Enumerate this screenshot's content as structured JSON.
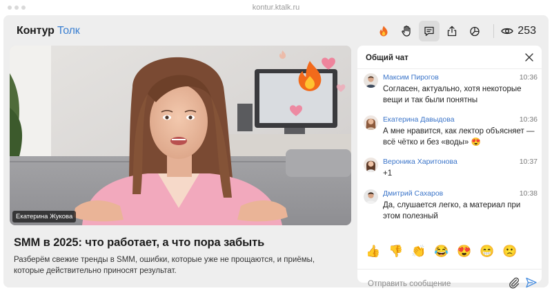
{
  "browser": {
    "url": "kontur.ktalk.ru"
  },
  "header": {
    "logo_brand": "Контур",
    "logo_product": "Толк",
    "viewer_count": "253",
    "toolbar_icons": [
      "fire-icon",
      "raise-hand-icon",
      "chat-icon",
      "share-icon",
      "poll-icon"
    ]
  },
  "video": {
    "speaker_name": "Екатерина Жукова",
    "reactions": [
      "fire",
      "heart",
      "heart",
      "heart",
      "fire"
    ]
  },
  "talk": {
    "title": "SMM в 2025: что работает, а что пора забыть",
    "description": "Разберём свежие тренды в SMM, ошибки, которые уже не прощаются, и приёмы, которые действительно приносят результат."
  },
  "chat": {
    "title": "Общий чат",
    "messages": [
      {
        "author": "Максим Пирогов",
        "time": "10:36",
        "text": "Согласен, актуально, хотя некоторые вещи и так были понятны"
      },
      {
        "author": "Екатерина Давыдова",
        "time": "10:36",
        "text": "А мне нравится, как лектор объясняет — всё чётко и без «воды» 😍"
      },
      {
        "author": "Вероника Харитонова",
        "time": "10:37",
        "text": "+1"
      },
      {
        "author": "Дмитрий Сахаров",
        "time": "10:38",
        "text": "Да, слушается легко, а материал при этом полезный"
      }
    ],
    "quick_reactions": [
      "👍",
      "👎",
      "👏",
      "😂",
      "😍",
      "😁",
      "🙁"
    ],
    "input_placeholder": "Отправить сообщение",
    "input_value": ""
  },
  "colors": {
    "accent": "#3a7fd1",
    "author_link": "#3a74c9",
    "send": "#4a8fe0",
    "app_background": "#eeeeee"
  }
}
